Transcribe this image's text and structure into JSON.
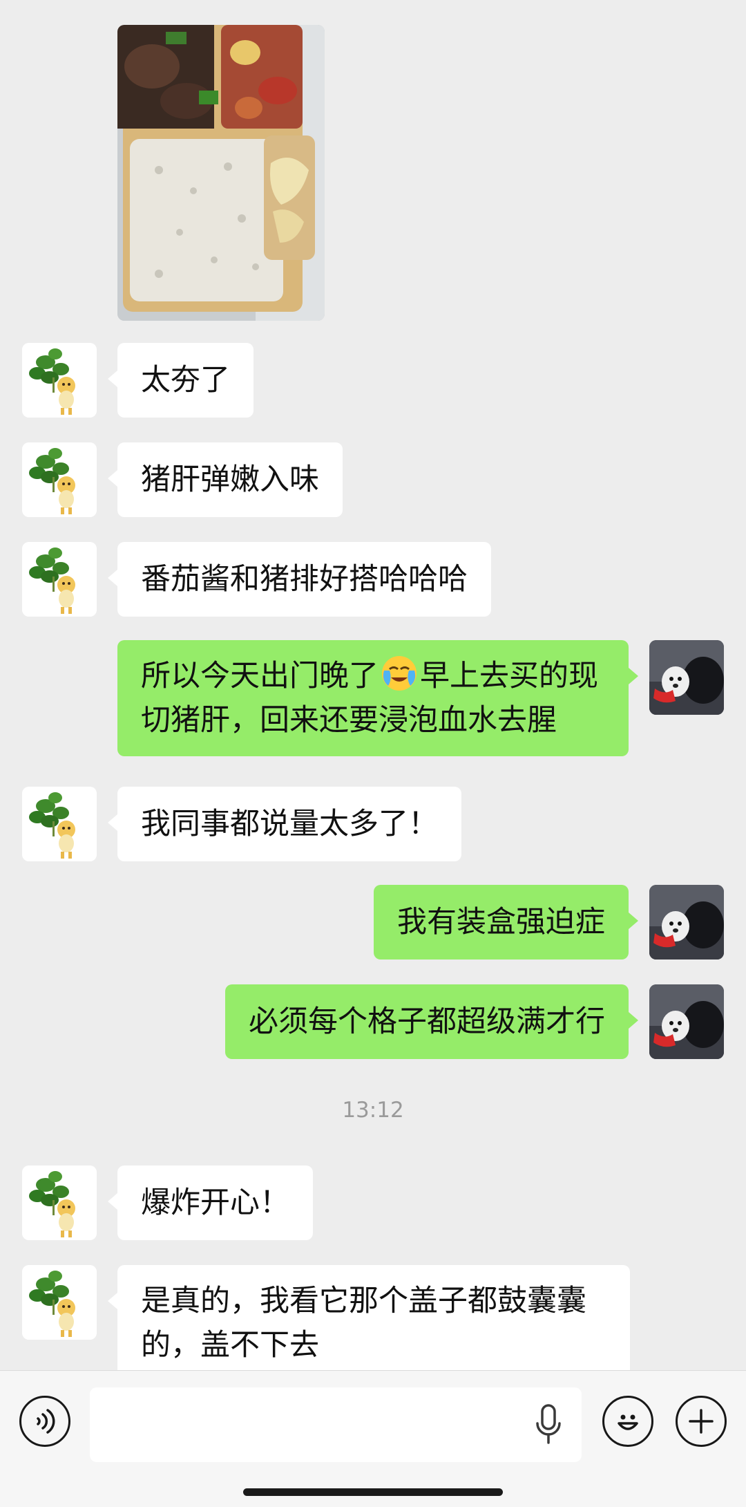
{
  "messages": [
    {
      "side": "in",
      "text": "太夯了"
    },
    {
      "side": "in",
      "text": "猪肝弹嫩入味"
    },
    {
      "side": "in",
      "text": "番茄酱和猪排好搭哈哈哈"
    },
    {
      "side": "out",
      "line1_before": "所以今天出门晚了",
      "emoji": "face-with-tears-emoji",
      "line1_after": "早上去买的现",
      "line2": "切猪肝，回来还要浸泡血水去腥"
    },
    {
      "side": "in",
      "text": "我同事都说量太多了！"
    },
    {
      "side": "out",
      "text": "我有装盒强迫症"
    },
    {
      "side": "out",
      "text": "必须每个格子都超级满才行"
    },
    {
      "side": "in",
      "text": "爆炸开心！"
    },
    {
      "side": "in",
      "line1": "是真的，我看它那个盖子都鼓囊囊",
      "line2": "的，盖不下去"
    }
  ],
  "timestamp": "13:12",
  "input": {
    "value": "",
    "placeholder": ""
  },
  "icons": {
    "voice": "voice-toggle-icon",
    "mic": "microphone-icon",
    "emoji": "emoji-face-icon",
    "plus": "plus-icon"
  },
  "colors": {
    "background": "#ededed",
    "incoming_bubble": "#ffffff",
    "outgoing_bubble": "#95ec69",
    "timestamp": "#9a9a9a"
  }
}
